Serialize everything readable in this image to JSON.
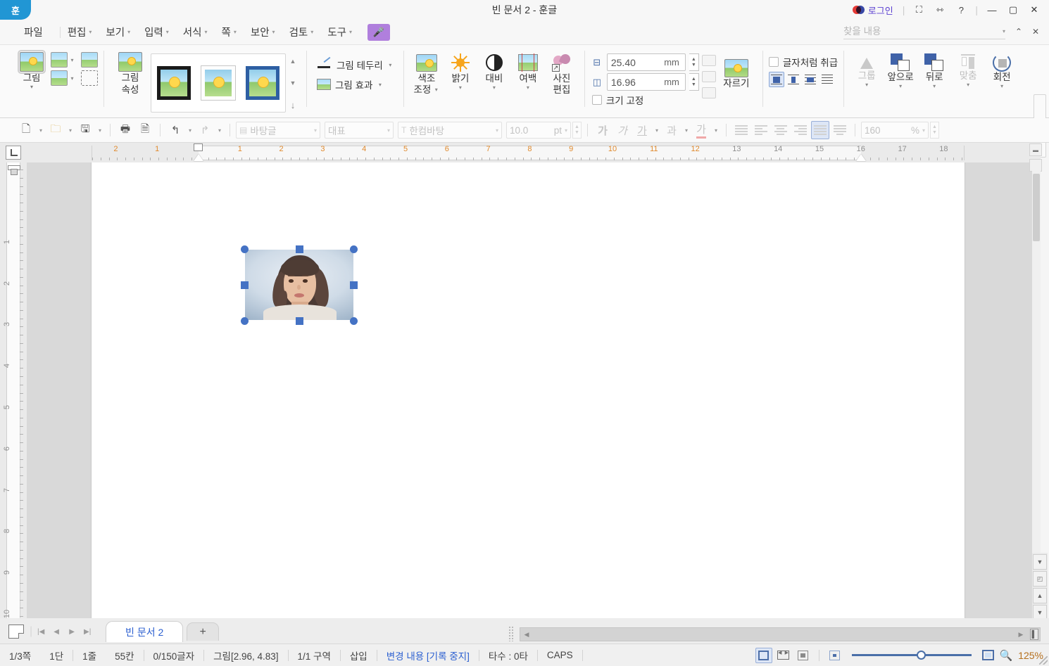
{
  "titlebar": {
    "logo": "hangul-logo",
    "title": "빈 문서 2 - 훈글",
    "login_label": "로그인",
    "icons": [
      "expand-icon",
      "resize-icon",
      "help-icon"
    ],
    "window_buttons": [
      "minimize",
      "maximize",
      "close"
    ],
    "login_color": "#5b3fd1"
  },
  "menubar": {
    "items": [
      {
        "label": "파일",
        "caret": false
      },
      {
        "label": "편집",
        "caret": true
      },
      {
        "label": "보기",
        "caret": true
      },
      {
        "label": "입력",
        "caret": true
      },
      {
        "label": "서식",
        "caret": true
      },
      {
        "label": "쪽",
        "caret": true
      },
      {
        "label": "보안",
        "caret": true
      },
      {
        "label": "검토",
        "caret": true
      },
      {
        "label": "도구",
        "caret": true
      }
    ],
    "mic_button": "mic-icon",
    "mic_color": "#b07fdd"
  },
  "find": {
    "placeholder": "찾을 내용",
    "value": ""
  },
  "ribbon": {
    "picture_button": {
      "label": "그림"
    },
    "picture_props": {
      "label": "그림\n속성",
      "line1": "그림",
      "line2": "속성"
    },
    "gallery": {
      "styles": [
        "black-frame-thumb",
        "white-frame-thumb",
        "blue-frame-thumb"
      ],
      "scroll": [
        "scroll-up",
        "scroll-down",
        "gallery-expand"
      ]
    },
    "border_label": "그림 테두리",
    "effect_label": "그림 효과",
    "adjust": [
      {
        "line1": "색조",
        "line2": "조정",
        "icon": "tone-adjust-icon",
        "caret": true
      },
      {
        "line1": "밝기",
        "line2": "",
        "icon": "brightness-icon",
        "caret": true
      },
      {
        "line1": "대비",
        "line2": "",
        "icon": "contrast-icon",
        "caret": true
      },
      {
        "line1": "여백",
        "line2": "",
        "icon": "margin-icon",
        "caret": true
      },
      {
        "line1": "사진",
        "line2": "편집",
        "icon": "photo-edit-icon",
        "caret": false
      }
    ],
    "size": {
      "height_value": "25.40",
      "height_unit": "mm",
      "width_value": "16.96",
      "width_unit": "mm",
      "lock_label": "크기 고정",
      "lock_checked": false
    },
    "crop_label": "자르기",
    "treat_as_char": {
      "label": "글자처럼 취급",
      "checked": false
    },
    "wrap_buttons": [
      "wrap-inline",
      "wrap-top-bottom",
      "wrap-tight",
      "wrap-behind"
    ],
    "arrange": [
      {
        "label": "그룹",
        "disabled": true,
        "caret": true
      },
      {
        "label": "앞으로",
        "disabled": false,
        "caret": true
      },
      {
        "label": "뒤로",
        "disabled": false,
        "caret": true
      },
      {
        "label": "맞춤",
        "disabled": true,
        "caret": true
      },
      {
        "label": "회전",
        "disabled": false,
        "caret": true
      }
    ],
    "more": "»"
  },
  "formatbar": {
    "file_icons": [
      "new-doc-icon",
      "open-folder-icon",
      "save-icon"
    ],
    "print_icons": [
      "print-icon",
      "preview-icon"
    ],
    "history_icons": [
      "undo-icon",
      "redo-icon"
    ],
    "style_combo": "바탕글",
    "charstyle_combo": "대표",
    "font_combo": "한컴바탕",
    "font_size": "10.0",
    "font_size_unit": "pt",
    "char_buttons": [
      "bold-가",
      "italic-가",
      "underline-가",
      "strikethrough-과",
      "fontcolor-가"
    ],
    "align_buttons": [
      "align-justify",
      "align-left",
      "align-center",
      "align-right",
      "align-distribute",
      "align-divide"
    ],
    "line_spacing": "160",
    "line_spacing_unit": "%"
  },
  "ruler": {
    "horizontal_numbers": [
      "2",
      "1",
      "1",
      "2",
      "3",
      "4",
      "5",
      "6",
      "7",
      "8",
      "9",
      "10",
      "11",
      "12",
      "13",
      "14",
      "15",
      "16",
      "17",
      "18"
    ],
    "vertical_numbers": [
      "1",
      "2",
      "3",
      "4",
      "5",
      "6",
      "7",
      "8",
      "9",
      "10"
    ],
    "number_color": "#e08a2e",
    "gray_color": "#8f8f8f"
  },
  "document": {
    "image": {
      "alt": "child-portrait",
      "selected": true,
      "handles": [
        "nw",
        "n",
        "ne",
        "w",
        "e",
        "sw",
        "s",
        "se"
      ],
      "handle_color": "#4472c4"
    }
  },
  "tabbar": {
    "page_icon": "page-icon",
    "nav_buttons": [
      "first-page",
      "prev-page",
      "next-page",
      "last-page"
    ],
    "tabs": [
      {
        "label": "빈 문서 2",
        "active": true
      }
    ],
    "add_label": "+",
    "tab_color": "#2b5fd0"
  },
  "statusbar": {
    "items": [
      {
        "label": "1/3쪽",
        "blue": false
      },
      {
        "label": "1단",
        "blue": false
      },
      {
        "label": "1줄",
        "blue": false
      },
      {
        "label": "55칸",
        "blue": false
      },
      {
        "label": "0/150글자",
        "blue": false
      },
      {
        "label": "그림[2.96, 4.83]",
        "blue": false
      },
      {
        "label": "1/1 구역",
        "blue": false
      },
      {
        "label": "삽입",
        "blue": false
      },
      {
        "label": "변경 내용 [기록 중지]",
        "blue": true
      },
      {
        "label": "타수 : 0타",
        "blue": false
      },
      {
        "label": "CAPS",
        "blue": false
      }
    ],
    "view_buttons": [
      "single-page-view",
      "facing-page-view",
      "width-fit-view"
    ],
    "zoom_out_icon": "zoom-out-icon",
    "zoom_in_icon": "zoom-in-icon",
    "magnifier_icon": "magnifier-icon",
    "zoom_level": "125%",
    "zoom_color": "#b5701e"
  }
}
